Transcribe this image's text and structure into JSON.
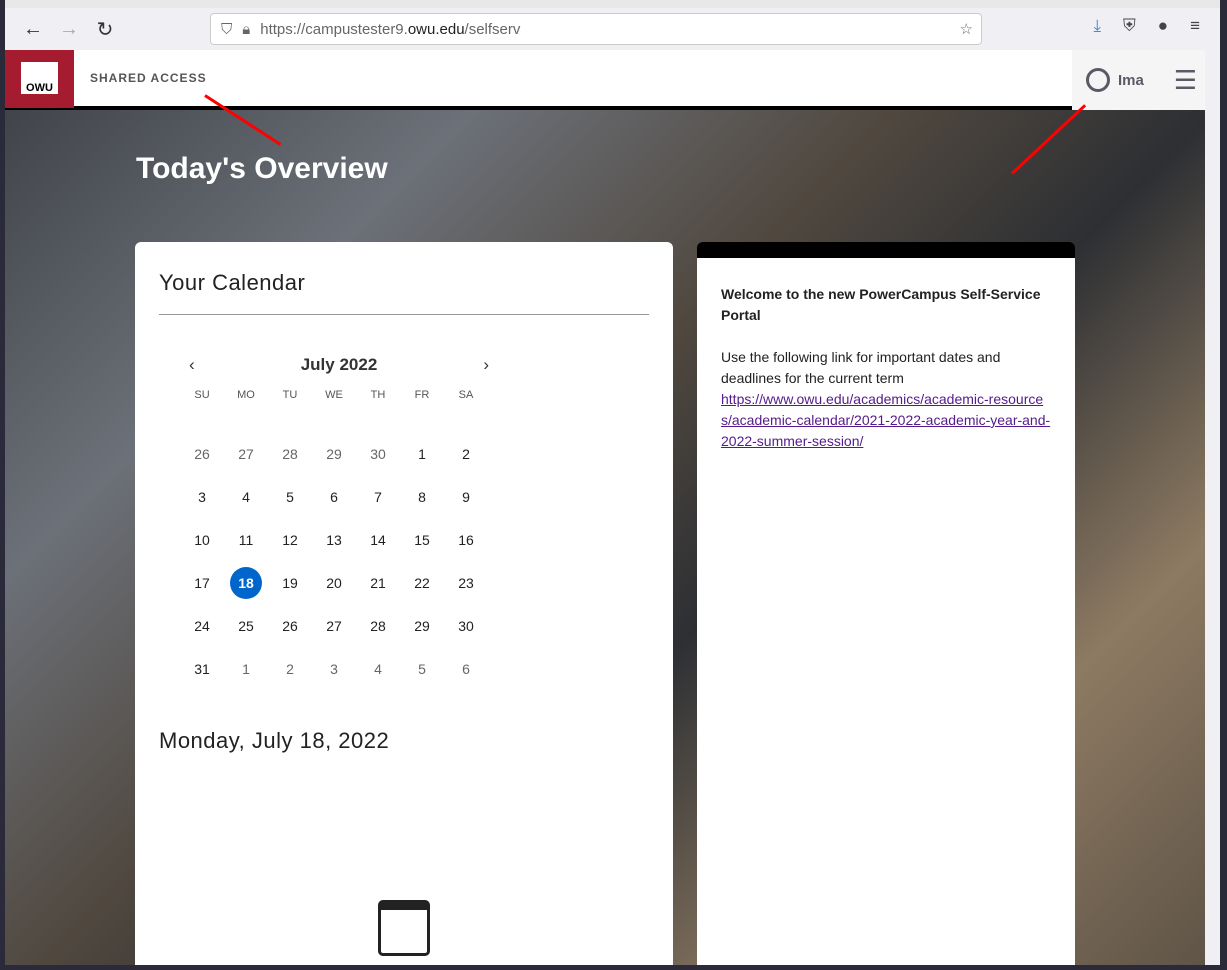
{
  "browser": {
    "url_prefix": "https://campustester9.",
    "url_domain": "owu.edu",
    "url_path": "/selfserv"
  },
  "header": {
    "logo_text": "OWU",
    "shared_access": "SHARED ACCESS",
    "user_name": "Ima"
  },
  "page_title": "Today's Overview",
  "calendar": {
    "title": "Your Calendar",
    "month": "July 2022",
    "days_of_week": [
      "SU",
      "MO",
      "TU",
      "WE",
      "TH",
      "FR",
      "SA"
    ],
    "weeks": [
      [
        "26",
        "27",
        "28",
        "29",
        "30",
        "1",
        "2"
      ],
      [
        "3",
        "4",
        "5",
        "6",
        "7",
        "8",
        "9"
      ],
      [
        "10",
        "11",
        "12",
        "13",
        "14",
        "15",
        "16"
      ],
      [
        "17",
        "18",
        "19",
        "20",
        "21",
        "22",
        "23"
      ],
      [
        "24",
        "25",
        "26",
        "27",
        "28",
        "29",
        "30"
      ],
      [
        "31",
        "1",
        "2",
        "3",
        "4",
        "5",
        "6"
      ]
    ],
    "selected": "18",
    "selected_date": "Monday, July 18, 2022"
  },
  "news": {
    "heading": "Welcome to the new PowerCampus Self-Service Portal",
    "body": "Use the following link for important dates and deadlines for the current term",
    "link": "https://www.owu.edu/academics/academic-resources/academic-calendar/2021-2022-academic-year-and-2022-summer-session/"
  },
  "colors": {
    "brand": "#a51c30",
    "accent": "#0066cc"
  }
}
